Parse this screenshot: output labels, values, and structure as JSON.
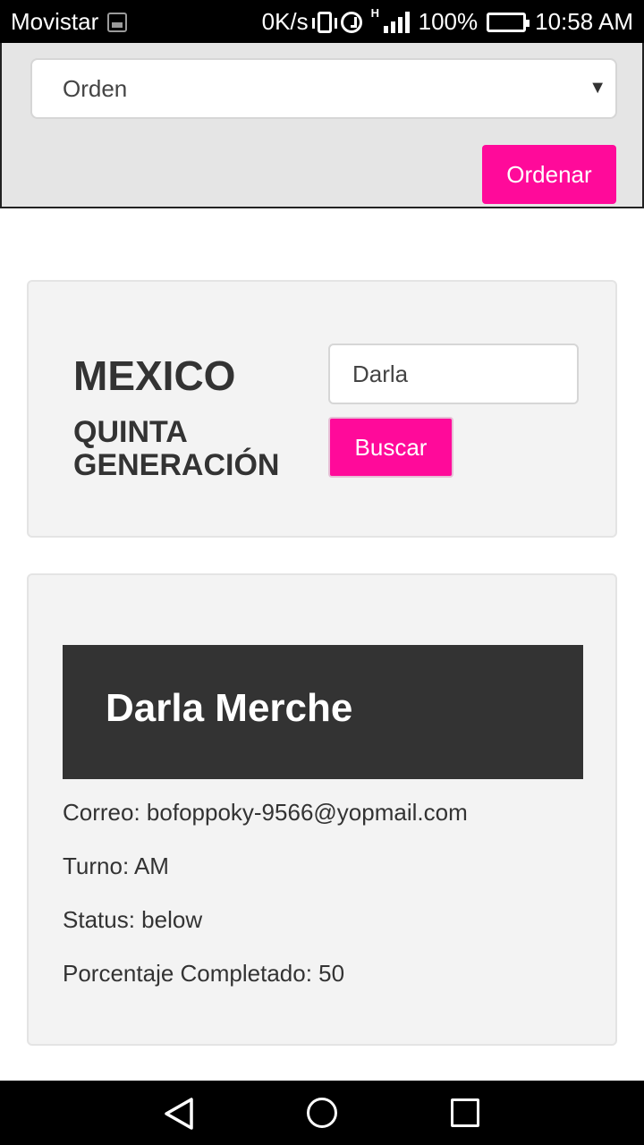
{
  "status_bar": {
    "carrier": "Movistar",
    "net_speed": "0K/s",
    "signal_tag": "H",
    "battery": "100%",
    "time": "10:58 AM"
  },
  "toolbar": {
    "order_select_value": "Orden",
    "order_button": "Ordenar"
  },
  "search_card": {
    "country": "MEXICO",
    "generation": "QUINTA GENERACIÓN",
    "search_value": "Darla",
    "search_button": "Buscar"
  },
  "result_card": {
    "name": "Darla Merche",
    "email": "Correo: bofoppoky-9566@yopmail.com",
    "shift": "Turno: AM",
    "status": "Status: below",
    "progress": "Porcentaje Completado: 50"
  },
  "colors": {
    "accent": "#ff0a9a",
    "header_dark": "#333333",
    "panel_bg": "#e5e5e5",
    "card_bg": "#f3f3f3"
  }
}
